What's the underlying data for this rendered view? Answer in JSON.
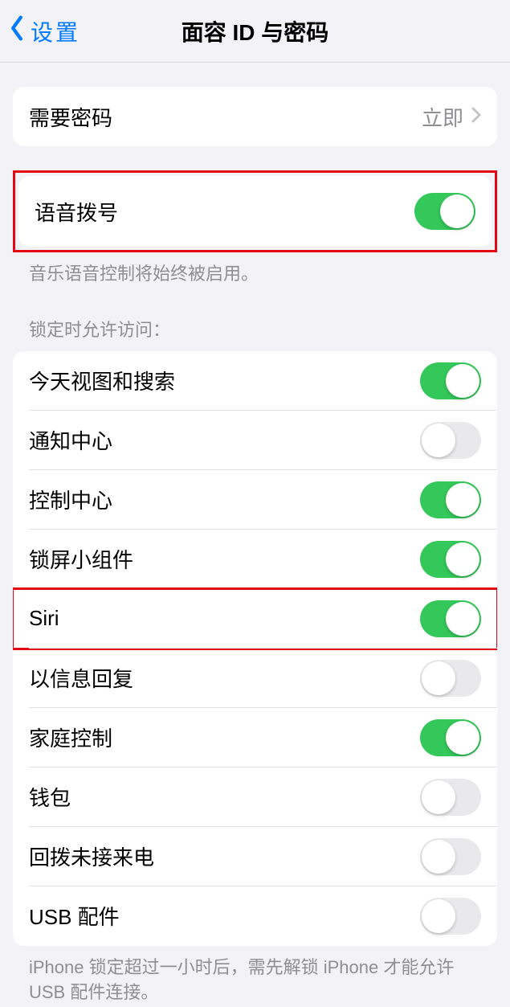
{
  "nav": {
    "back_label": "设置",
    "title": "面容 ID 与密码"
  },
  "passcode_row": {
    "label": "需要密码",
    "value": "立即"
  },
  "voice_dial": {
    "label": "语音拨号",
    "enabled": true,
    "footer": "音乐语音控制将始终被启用。"
  },
  "locked_access": {
    "header": "锁定时允许访问：",
    "items": [
      {
        "label": "今天视图和搜索",
        "enabled": true
      },
      {
        "label": "通知中心",
        "enabled": false
      },
      {
        "label": "控制中心",
        "enabled": true
      },
      {
        "label": "锁屏小组件",
        "enabled": true
      },
      {
        "label": "Siri",
        "enabled": true,
        "highlighted": true
      },
      {
        "label": "以信息回复",
        "enabled": false
      },
      {
        "label": "家庭控制",
        "enabled": true
      },
      {
        "label": "钱包",
        "enabled": false
      },
      {
        "label": "回拨未接来电",
        "enabled": false
      },
      {
        "label": "USB 配件",
        "enabled": false
      }
    ],
    "footer": "iPhone 锁定超过一小时后，需先解锁 iPhone 才能允许USB 配件连接。"
  }
}
